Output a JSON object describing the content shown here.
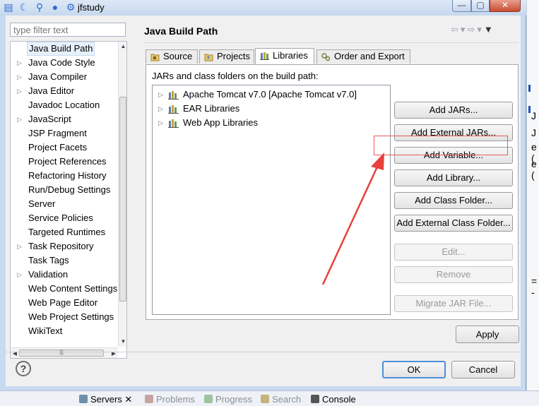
{
  "window": {
    "title": "jfstudy",
    "controls": {
      "minimize": "—",
      "maximize": "▢",
      "close": "✕"
    }
  },
  "background": {
    "right_fragments": [
      "J",
      "J",
      "e (",
      "e (",
      "= -"
    ],
    "bottom_tabs": [
      {
        "label": "Servers",
        "suffix": "✕",
        "active": true
      },
      {
        "label": "Problems",
        "active": false
      },
      {
        "label": "Progress",
        "active": false
      },
      {
        "label": "Search",
        "active": false
      },
      {
        "label": "Console",
        "active": false
      }
    ]
  },
  "filter": {
    "placeholder": "type filter text"
  },
  "tree": {
    "items": [
      {
        "label": "Java Build Path",
        "expandable": false,
        "selected": true
      },
      {
        "label": "Java Code Style",
        "expandable": true
      },
      {
        "label": "Java Compiler",
        "expandable": true
      },
      {
        "label": "Java Editor",
        "expandable": true
      },
      {
        "label": "Javadoc Location",
        "expandable": false
      },
      {
        "label": "JavaScript",
        "expandable": true
      },
      {
        "label": "JSP Fragment",
        "expandable": false
      },
      {
        "label": "Project Facets",
        "expandable": false
      },
      {
        "label": "Project References",
        "expandable": false
      },
      {
        "label": "Refactoring History",
        "expandable": false
      },
      {
        "label": "Run/Debug Settings",
        "expandable": false
      },
      {
        "label": "Server",
        "expandable": false
      },
      {
        "label": "Service Policies",
        "expandable": false
      },
      {
        "label": "Targeted Runtimes",
        "expandable": false
      },
      {
        "label": "Task Repository",
        "expandable": true
      },
      {
        "label": "Task Tags",
        "expandable": false
      },
      {
        "label": "Validation",
        "expandable": true
      },
      {
        "label": "Web Content Settings",
        "expandable": false
      },
      {
        "label": "Web Page Editor",
        "expandable": false
      },
      {
        "label": "Web Project Settings",
        "expandable": false
      },
      {
        "label": "WikiText",
        "expandable": false
      }
    ]
  },
  "page": {
    "title": "Java Build Path",
    "tabs": [
      {
        "label": "Source",
        "icon": "source-folder-icon",
        "active": false
      },
      {
        "label": "Projects",
        "icon": "projects-icon",
        "active": false
      },
      {
        "label": "Libraries",
        "icon": "libraries-icon",
        "active": true
      },
      {
        "label": "Order and Export",
        "icon": "order-export-icon",
        "active": false
      }
    ],
    "caption": "JARs and class folders on the build path:",
    "libraries": [
      "Apache Tomcat v7.0 [Apache Tomcat v7.0]",
      "EAR Libraries",
      "Web App Libraries"
    ],
    "buttons": [
      {
        "label": "Add JARs...",
        "enabled": true
      },
      {
        "label": "Add External JARs...",
        "enabled": true
      },
      {
        "label": "Add Variable...",
        "enabled": true
      },
      {
        "label": "Add Library...",
        "enabled": true,
        "highlighted": true
      },
      {
        "label": "Add Class Folder...",
        "enabled": true
      },
      {
        "label": "Add External Class Folder...",
        "enabled": true
      },
      {
        "label": "Edit...",
        "enabled": false
      },
      {
        "label": "Remove",
        "enabled": false
      },
      {
        "label": "Migrate JAR File...",
        "enabled": false
      }
    ],
    "apply": "Apply"
  },
  "footer": {
    "help": "?",
    "ok": "OK",
    "cancel": "Cancel"
  },
  "colors": {
    "annotation": "#e8403c",
    "accent": "#4f8ed8"
  }
}
